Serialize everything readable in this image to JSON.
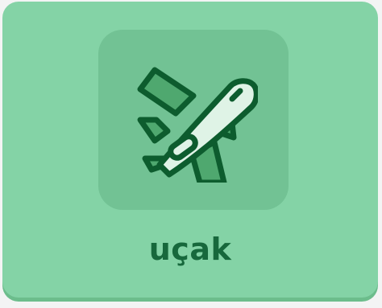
{
  "card": {
    "label": "uçak",
    "icon": "airplane-icon"
  },
  "colors": {
    "card_background": "#84d3a6",
    "icon_tile": "#72c294",
    "icon_stroke": "#0d5c2e",
    "label_text": "#17683c"
  }
}
